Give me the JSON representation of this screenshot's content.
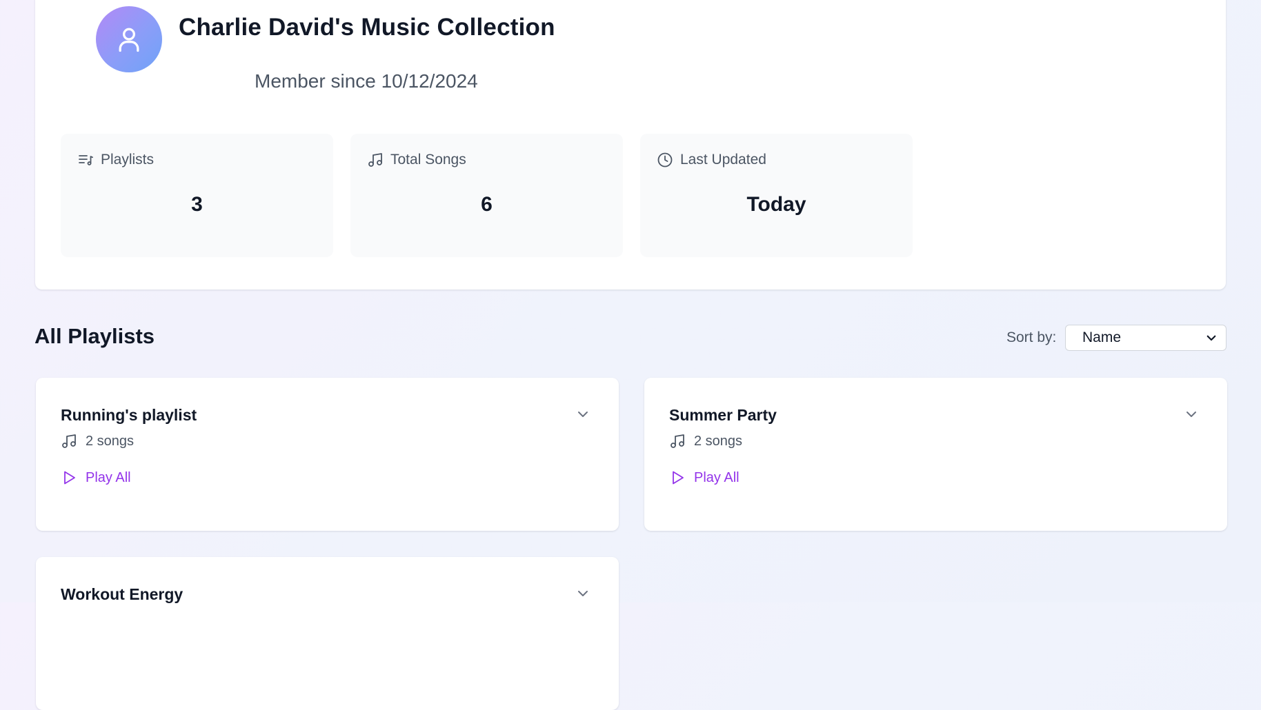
{
  "profile": {
    "title": "Charlie David's Music Collection",
    "member_since": "Member since 10/12/2024",
    "avatar_icon": "user-icon"
  },
  "stats": [
    {
      "label": "Playlists",
      "value": "3",
      "icon": "playlist-icon"
    },
    {
      "label": "Total Songs",
      "value": "6",
      "icon": "music-note-icon"
    },
    {
      "label": "Last Updated",
      "value": "Today",
      "icon": "clock-icon"
    }
  ],
  "playlists_section": {
    "title": "All Playlists",
    "sort_label": "Sort by:",
    "sort_value": "Name"
  },
  "playlists": [
    {
      "name": "Running's playlist",
      "song_count": "2 songs",
      "play_label": "Play All"
    },
    {
      "name": "Summer Party",
      "song_count": "2 songs",
      "play_label": "Play All"
    },
    {
      "name": "Workout Energy"
    }
  ],
  "colors": {
    "accent": "#9333ea",
    "avatar_gradient_start": "#b389f6",
    "avatar_gradient_end": "#6fa3f7",
    "text_primary": "#111827",
    "text_secondary": "#4b5563"
  }
}
